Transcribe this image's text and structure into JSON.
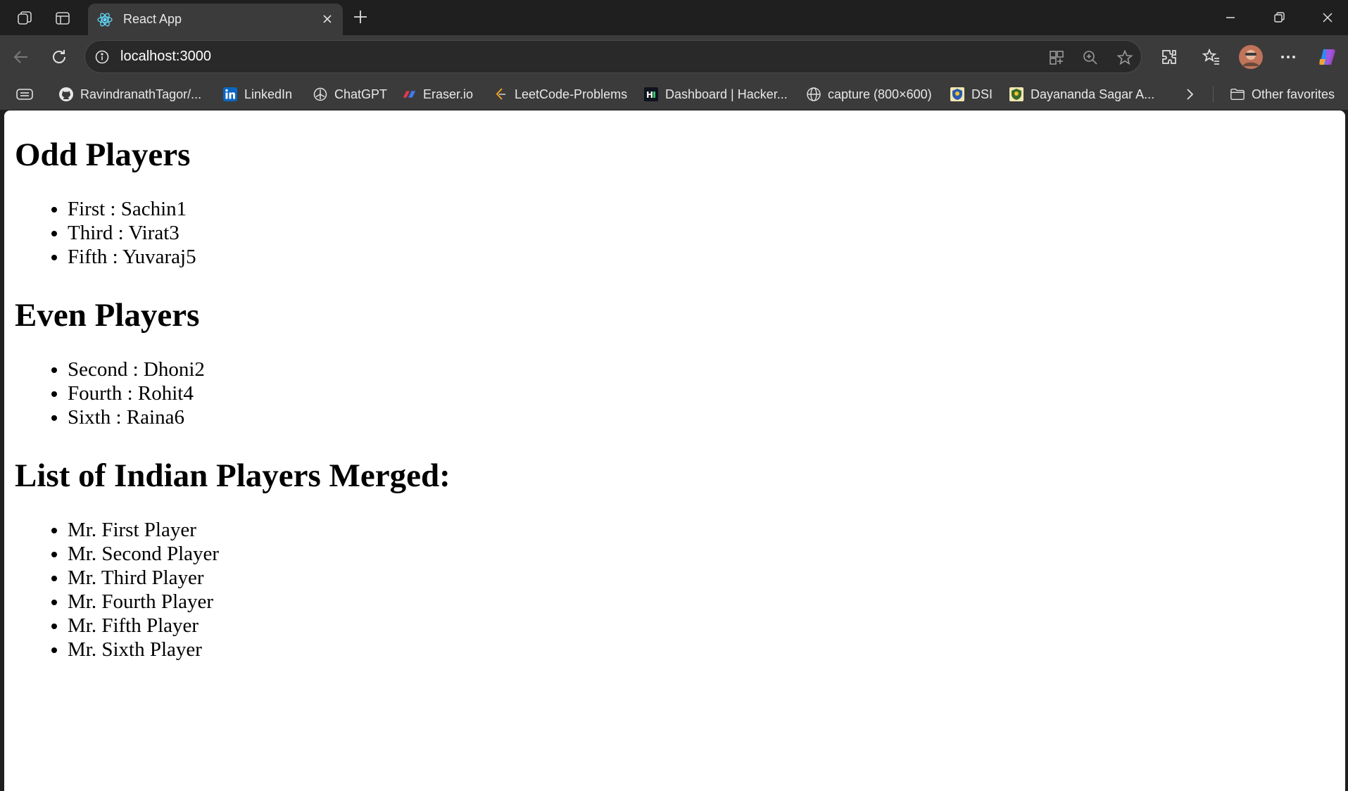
{
  "browser": {
    "tab_title": "React App",
    "url": "localhost:3000"
  },
  "bookmarks": [
    {
      "label": "RavindranathTagor/...",
      "icon": "github-icon"
    },
    {
      "label": "LinkedIn",
      "icon": "linkedin-icon"
    },
    {
      "label": "ChatGPT",
      "icon": "chatgpt-icon"
    },
    {
      "label": "Eraser.io",
      "icon": "eraser-icon"
    },
    {
      "label": "LeetCode-Problems",
      "icon": "leetcode-icon"
    },
    {
      "label": "Dashboard | Hacker...",
      "icon": "hackerrank-icon"
    },
    {
      "label": "capture (800×600)",
      "icon": "globe-icon"
    },
    {
      "label": "DSI",
      "icon": "dsi-icon"
    },
    {
      "label": "Dayananda Sagar A...",
      "icon": "dsu-icon"
    }
  ],
  "other_favorites": "Other favorites",
  "content": {
    "odd_heading": "Odd Players",
    "odd_players": [
      "First : Sachin1",
      "Third : Virat3",
      "Fifth : Yuvaraj5"
    ],
    "even_heading": "Even Players",
    "even_players": [
      "Second : Dhoni2",
      "Fourth : Rohit4",
      "Sixth : Raina6"
    ],
    "merged_heading": "List of Indian Players Merged:",
    "merged_players": [
      "Mr. First Player",
      "Mr. Second Player",
      "Mr. Third Player",
      "Mr. Fourth Player",
      "Mr. Fifth Player",
      "Mr. Sixth Player"
    ]
  }
}
